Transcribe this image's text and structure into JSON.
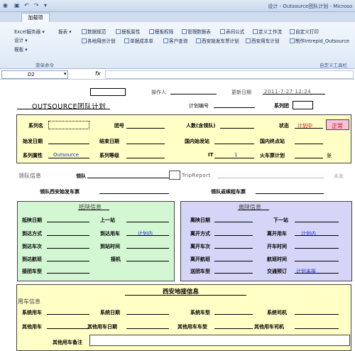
{
  "window": {
    "title": "设计 - Outsource团队计划 - Microso"
  },
  "ribbon": {
    "tab_addin": "加载项",
    "row1": [
      "Excel服务器",
      "报表",
      "数据规范",
      "模板属性",
      "模板权限",
      "管理数据表",
      "表间公式",
      "定义工作流",
      "自定义打印"
    ],
    "row2": [
      "设计",
      "各地用房计划",
      "单据成本单",
      "客户查询",
      "西安始发车票计划",
      "西安用车计划",
      "制作Intrepid_Outsource"
    ],
    "row3": [
      "模板"
    ],
    "group_left": "菜单命令",
    "group_right": "自定义工具栏"
  },
  "formula_bar": {
    "name_box": "D2",
    "fx": "fx"
  },
  "sheet": {
    "title": "OUTSOURCE团队计划",
    "operator_label": "操作人",
    "update_date_label": "更新日期",
    "update_date_value": "2011-7-27 12:24",
    "plan_no_label": "计划编号",
    "series_group_label": "系列团",
    "series_name_label": "系列名",
    "group_no_label": "团号",
    "people_label": "人数(含领队)",
    "status_label": "状态",
    "status_value": "计划中",
    "status_flag": "正常",
    "start_date_label": "始发日期",
    "end_date_label": "结束日期",
    "domestic_start_label": "国内始发站",
    "domestic_end_label": "国内终点站",
    "series_attr_label": "系列属性",
    "series_attr_value": "Outsource",
    "series_level_label": "系列等级",
    "it_label": "IT",
    "it_value": "1",
    "train_plan_label": "火车票计划",
    "train_plan_unit": "张",
    "leader_section": "领队信息",
    "leader_label": "领队",
    "trip_report": "TripReport",
    "unsent": "未发",
    "leader_xian_ticket": "领队西安始发车票",
    "leader_return_ticket": "领队返续程车票",
    "arrive": {
      "title": "抵陕信息",
      "date": "抵陕日期",
      "prev_stop": "上一站",
      "method": "到达方式",
      "car_use": "到达用车",
      "car_use_value": "计划内",
      "train": "到达车次",
      "time": "到站时间",
      "flight": "到达航班",
      "airport": "接机",
      "pickup_model": "接团车型"
    },
    "depart": {
      "title": "离陕信息",
      "date": "离陕日期",
      "next_stop": "下一站",
      "method": "离开方式",
      "car_use": "离开用车",
      "car_use_value": "计划内",
      "train": "离开车次",
      "time": "开车时间",
      "flight": "离开航班",
      "flight_time": "航班时间",
      "send_model": "送团车型",
      "transport": "交通预订",
      "transport_value": "计划未报"
    },
    "xian": {
      "title": "西安地接信息",
      "car_section": "用车信息",
      "system_car": "系统用车",
      "system_date": "系统日期",
      "system_model": "系统车型",
      "system_driver": "系统司机",
      "other_car": "其他用车",
      "other_date": "其他用车日期",
      "other_model": "其他用车车型",
      "other_driver": "其他用车司机",
      "other_note": "其他用车备注"
    }
  }
}
